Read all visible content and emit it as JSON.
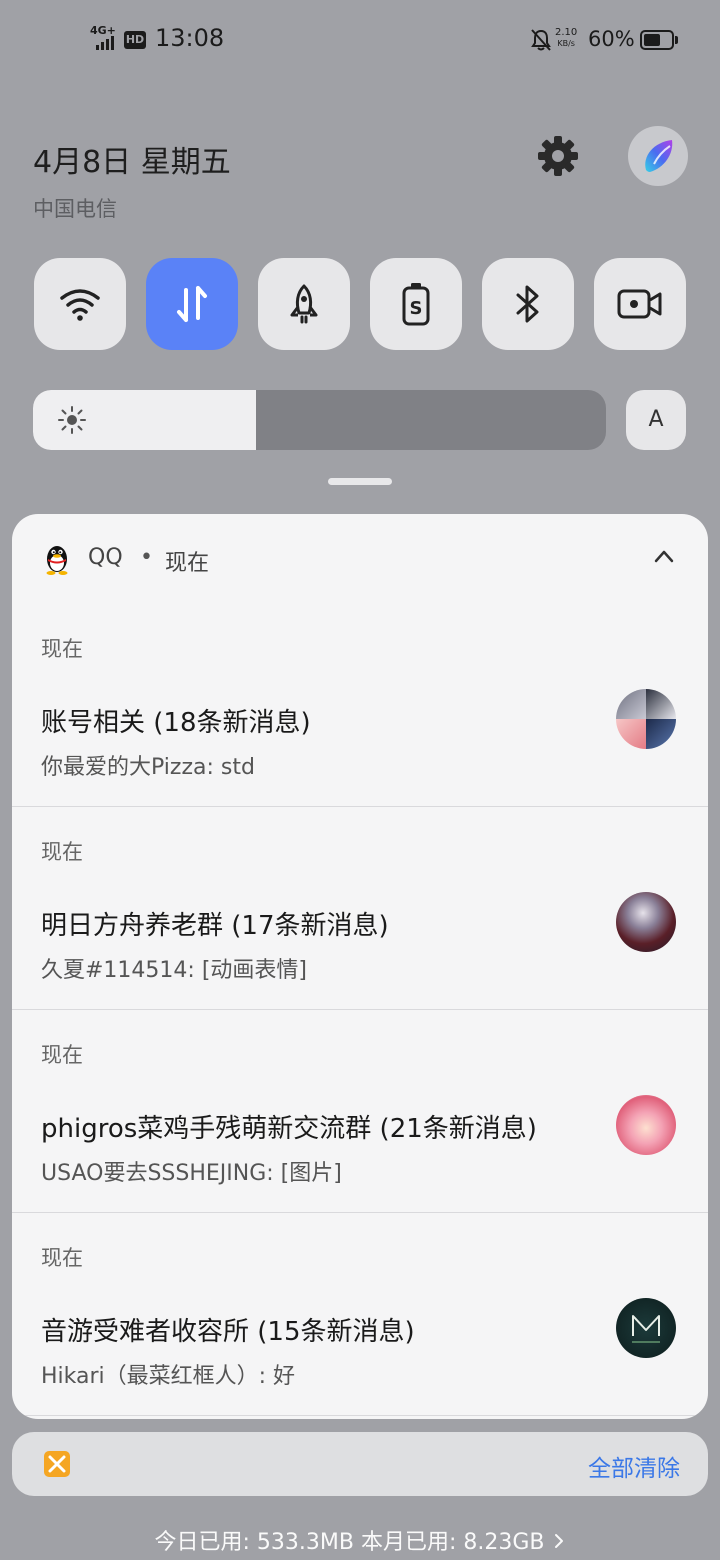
{
  "status_bar": {
    "network": "4G+",
    "hd": "HD",
    "time": "13:08",
    "speed_value": "2.10",
    "speed_unit": "KB/s",
    "battery_pct": "60%",
    "battery_level": 0.6
  },
  "header": {
    "date": "4月8日 星期五",
    "carrier": "中国电信"
  },
  "quick_toggles": [
    {
      "icon": "wifi-icon",
      "active": false
    },
    {
      "icon": "mobile-data-icon",
      "active": true
    },
    {
      "icon": "rocket-icon",
      "active": false
    },
    {
      "icon": "battery-saver-icon",
      "active": false
    },
    {
      "icon": "bluetooth-icon",
      "active": false
    },
    {
      "icon": "screen-record-icon",
      "active": false
    }
  ],
  "brightness": {
    "level": 0.39,
    "auto_label": "A"
  },
  "notification_group": {
    "app_name": "QQ",
    "separator": "•",
    "time": "现在",
    "items": [
      {
        "time": "现在",
        "title": "账号相关 (18条新消息)",
        "body": "你最爱的大Pizza: std"
      },
      {
        "time": "现在",
        "title": "明日方舟养老群 (17条新消息)",
        "body": "久夏#114514: [动画表情]"
      },
      {
        "time": "现在",
        "title": "phigros菜鸡手残萌新交流群 (21条新消息)",
        "body": "USAO要去SSSHEJING: [图片]"
      },
      {
        "time": "现在",
        "title": "音游受难者收容所 (15条新消息)",
        "body": "Hikari（最菜红框人）: 好"
      }
    ]
  },
  "bottom": {
    "clear_all": "全部清除",
    "usage": "今日已用: 533.3MB 本月已用: 8.23GB"
  },
  "colors": {
    "accent": "#5a82f7",
    "link": "#3b78e7",
    "backdrop": "#a0a1a6"
  }
}
